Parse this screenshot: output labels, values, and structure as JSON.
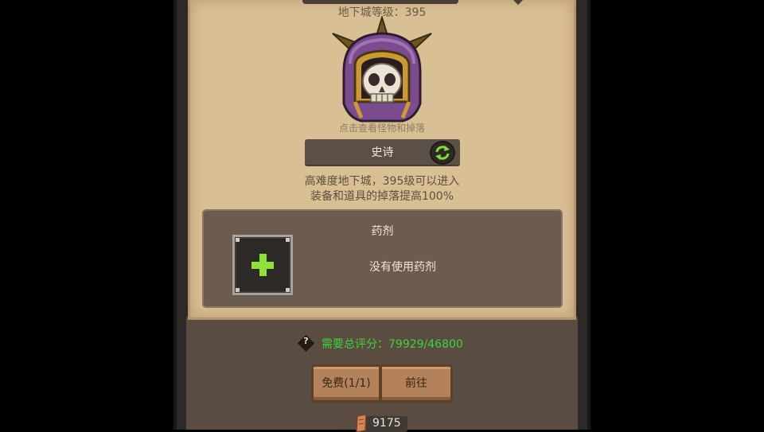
{
  "dungeon": {
    "level_label": "地下城等级：395",
    "hint": "点击查看怪物和掉落",
    "difficulty": "史诗",
    "description_line1": "高难度地下城，395级可以进入",
    "description_line2": "装备和道具的掉落提高100%"
  },
  "potion": {
    "title": "药剂",
    "empty_text": "没有使用药剂"
  },
  "requirement": {
    "icon": "?",
    "text": "需要总评分：79929/46800"
  },
  "buttons": {
    "free": "免费(1/1)",
    "go": "前往"
  },
  "currency": {
    "value": "9175"
  },
  "icons": {
    "helmet": "skull-helmet-icon",
    "swap": "swap-arrows-icon",
    "add": "plus-icon",
    "currency": "scroll-icon"
  },
  "colors": {
    "parchment": "#d9bf94",
    "requirement_green": "#3fd13f",
    "plus_green": "#8ee03a"
  }
}
